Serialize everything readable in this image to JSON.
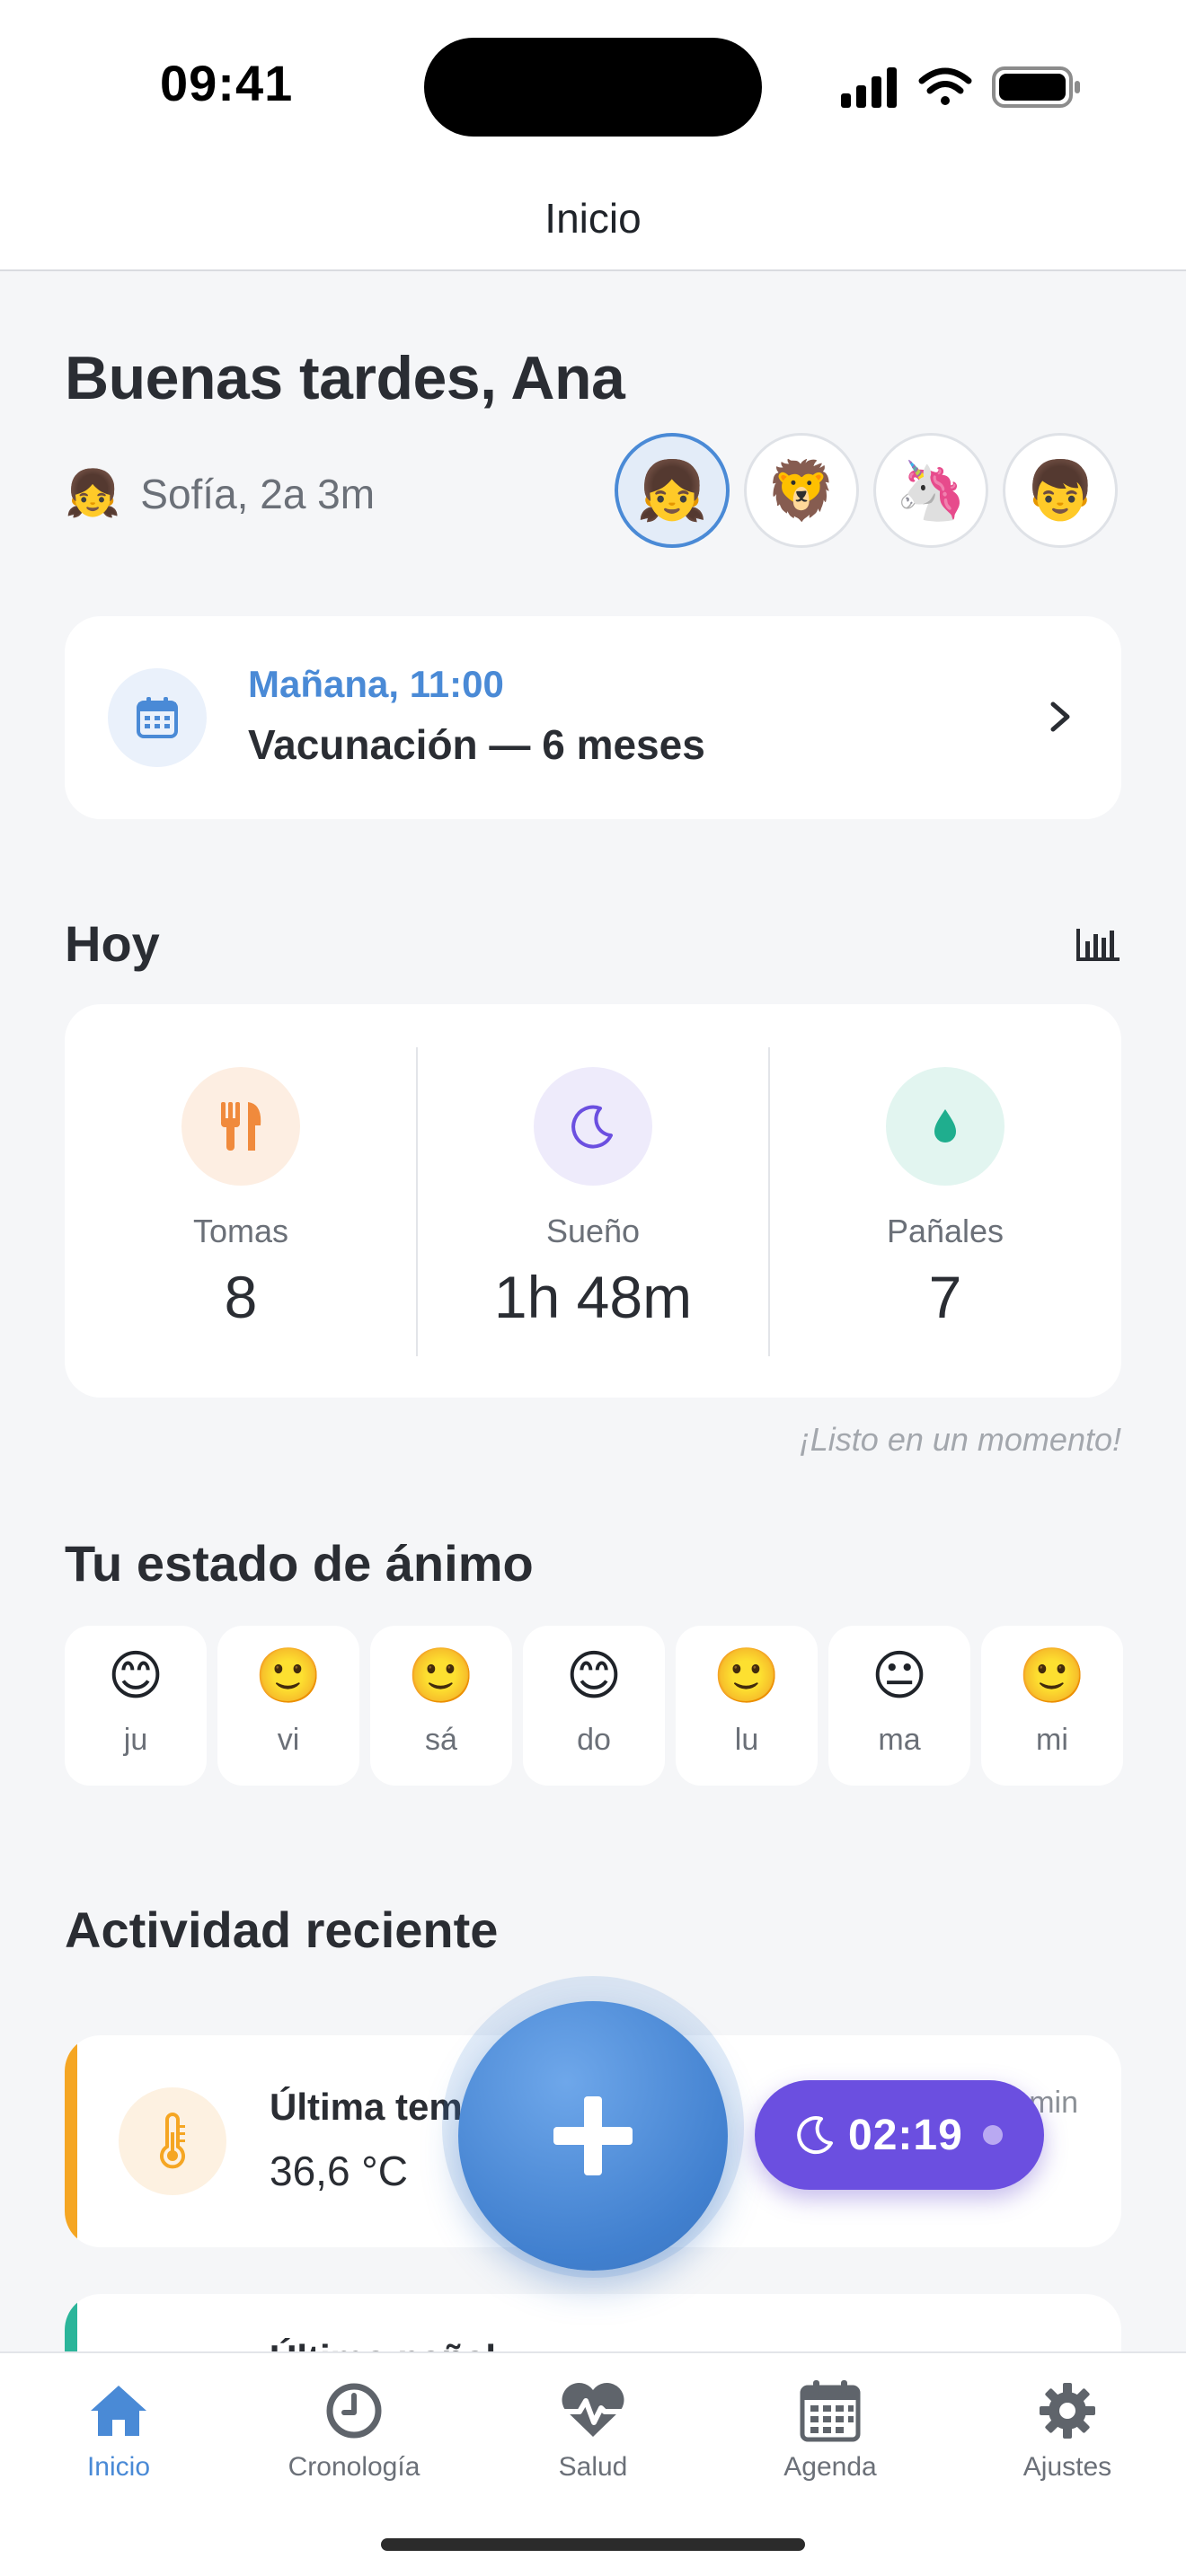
{
  "status_bar": {
    "time": "09:41"
  },
  "nav": {
    "title": "Inicio"
  },
  "greeting": "Buenas tardes, Ana",
  "child": {
    "emoji": "👧",
    "label": "Sofía, 2a 3m"
  },
  "avatars": [
    {
      "emoji": "👧",
      "active": true
    },
    {
      "emoji": "🦁",
      "active": false
    },
    {
      "emoji": "🦄",
      "active": false
    },
    {
      "emoji": "👦",
      "active": false
    }
  ],
  "appointment": {
    "icon": "calendar-icon",
    "when": "Mañana, 11:00",
    "what": "Vacunación — 6 meses"
  },
  "today": {
    "title": "Hoy",
    "stats": [
      {
        "label": "Tomas",
        "value": "8",
        "icon": "fork-knife-icon",
        "color": "#f08a3c",
        "bg": "#fdeee2"
      },
      {
        "label": "Sueño",
        "value": "1h 48m",
        "icon": "moon-icon",
        "color": "#6b4fe0",
        "bg": "#eeebfb"
      },
      {
        "label": "Pañales",
        "value": "7",
        "icon": "drop-icon",
        "color": "#1fae8e",
        "bg": "#e2f5f0"
      }
    ],
    "hint": "¡Listo en un momento!"
  },
  "mood": {
    "title": "Tu estado de ánimo",
    "days": [
      {
        "day": "ju",
        "face": "😊"
      },
      {
        "day": "vi",
        "face": "🙂"
      },
      {
        "day": "sá",
        "face": "🙂"
      },
      {
        "day": "do",
        "face": "😊"
      },
      {
        "day": "lu",
        "face": "🙂"
      },
      {
        "day": "ma",
        "face": "😐"
      },
      {
        "day": "mi",
        "face": "🙂"
      }
    ]
  },
  "recent": {
    "title": "Actividad reciente",
    "items": [
      {
        "title": "Última tem",
        "value": "36,6 °C",
        "time": "min",
        "icon": "thermometer-icon",
        "accent": "#f5a623"
      },
      {
        "title": "Último pañal",
        "accent": "#2bb59a"
      }
    ]
  },
  "sleep_timer": {
    "value": "02:19"
  },
  "tabbar": {
    "tabs": [
      {
        "label": "Inicio",
        "icon": "home-icon",
        "active": true
      },
      {
        "label": "Cronología",
        "icon": "clock-icon",
        "active": false
      },
      {
        "label": "Salud",
        "icon": "heart-pulse-icon",
        "active": false
      },
      {
        "label": "Agenda",
        "icon": "calendar-icon",
        "active": false
      },
      {
        "label": "Ajustes",
        "icon": "gear-icon",
        "active": false
      }
    ]
  },
  "colors": {
    "accent": "#4a8ad6",
    "sleep": "#6b4fe0",
    "background": "#f5f6f8"
  }
}
